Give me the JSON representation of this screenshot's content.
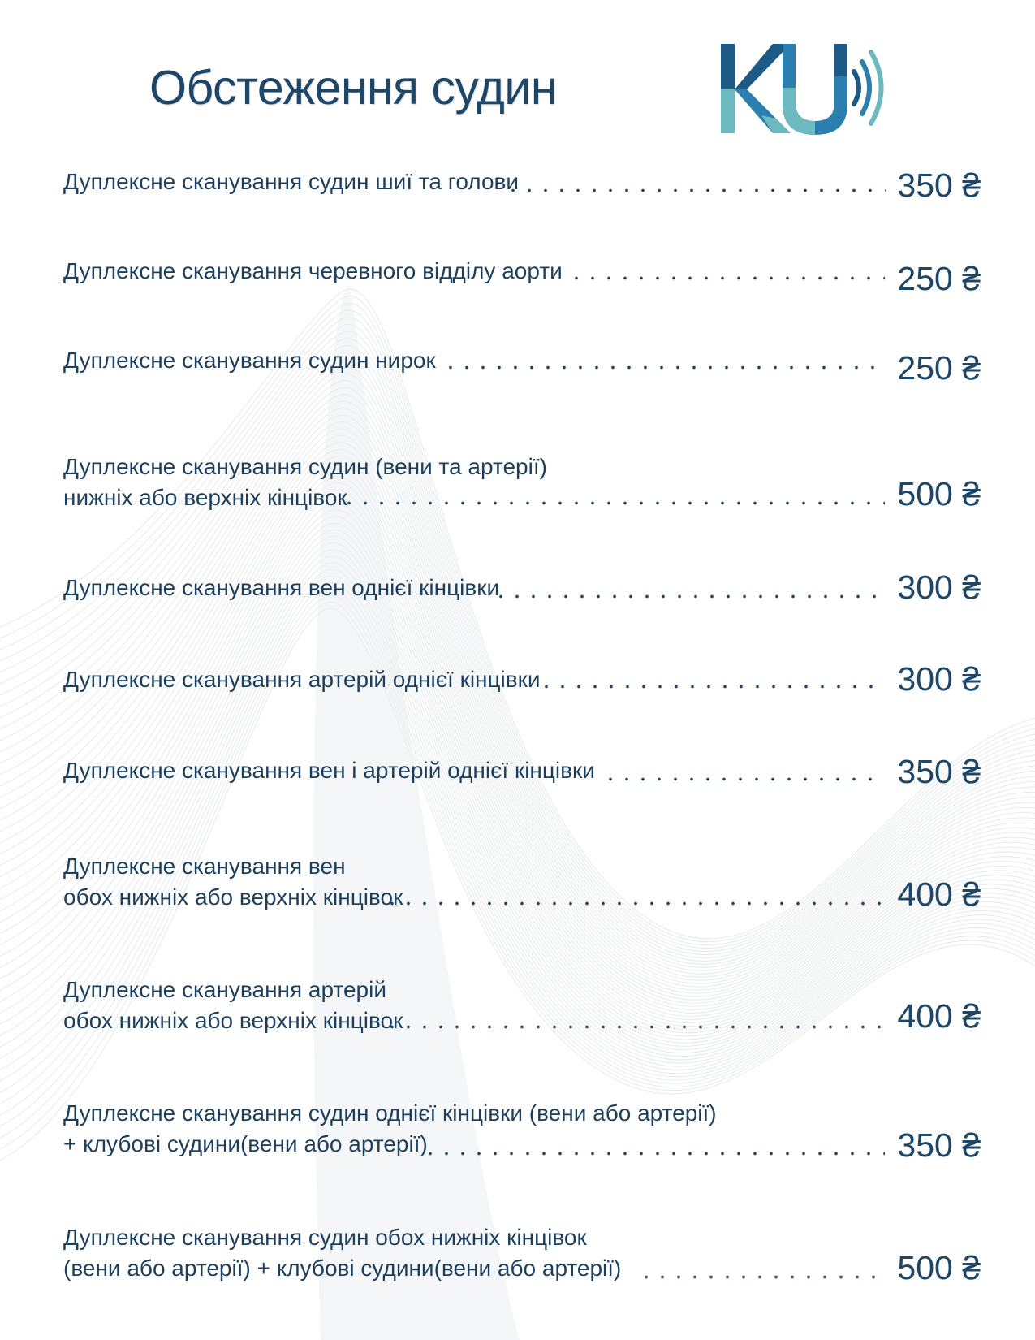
{
  "page": {
    "title": "Обстеження судин",
    "logo_text": "KU",
    "colors": {
      "primary": "#1d4668",
      "text": "#1d3f5e",
      "logo_dark": "#1d5a85",
      "logo_mid": "#2b7fae",
      "logo_light": "#6cbac0"
    }
  },
  "services": [
    {
      "lines": [
        "Дуплексне сканування судин шиї та голови"
      ],
      "price": "350 ₴"
    },
    {
      "lines": [
        "Дуплексне сканування черевного відділу аорти"
      ],
      "price": "250 ₴"
    },
    {
      "lines": [
        "Дуплексне сканування судин нирок"
      ],
      "price": "250 ₴"
    },
    {
      "lines": [
        "Дуплексне сканування судин (вени та артерії)",
        "нижніх або верхніх кінцівок"
      ],
      "price": "500 ₴"
    },
    {
      "lines": [
        "Дуплексне сканування вен однієї кінцівки"
      ],
      "price": "300 ₴"
    },
    {
      "lines": [
        "Дуплексне сканування артерій однієї кінцівки"
      ],
      "price": "300 ₴"
    },
    {
      "lines": [
        "Дуплексне сканування вен і артерій однієї кінцівки"
      ],
      "price": "350 ₴"
    },
    {
      "lines": [
        "Дуплексне сканування вен",
        "обох нижніх або верхніх кінцівок"
      ],
      "price": "400 ₴"
    },
    {
      "lines": [
        "Дуплексне сканування артерій",
        "обох нижніх або верхніх кінцівок"
      ],
      "price": "400 ₴"
    },
    {
      "lines": [
        "Дуплексне сканування судин однієї кінцівки (вени або артерії)",
        "+ клубові судини(вени або артерії)"
      ],
      "price": "350 ₴"
    },
    {
      "lines": [
        "Дуплексне сканування судин обох нижніх кінцівок",
        "(вени або артерії) + клубові судини(вени або артерії)"
      ],
      "price": "500 ₴"
    }
  ]
}
